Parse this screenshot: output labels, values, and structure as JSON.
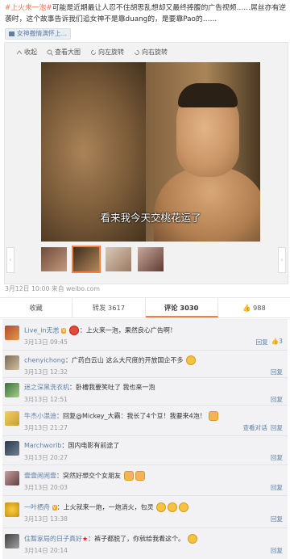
{
  "post": {
    "hashtag": "#上火来一泡#",
    "text": "可能是近期最让人忍不住胡思乱想却又最终捧腹的广告视频……屌丝亦有逆袭时，这个故事告诉我们追女神不是靠duang的，是要靠Pao的……",
    "video_link": "女神撒情满怀上..."
  },
  "toolbar": {
    "collapse": "收起",
    "view_large": "查看大图",
    "rotate_left": "向左旋转",
    "rotate_right": "向右旋转"
  },
  "image": {
    "caption": "看来我今天交桃花运了"
  },
  "meta": {
    "date_source": "3月12日 10:00 来自 weibo.com"
  },
  "actions": [
    {
      "label": "收藏"
    },
    {
      "label": "转发 3617"
    },
    {
      "label": "评论 3030"
    },
    {
      "label": "988"
    }
  ],
  "comments": [
    {
      "user": "Live_in无恙",
      "badge": "V",
      "text": "：上火来一泡，果然良心广告啊！",
      "time": "3月13日 09:45",
      "ops": [
        "回复"
      ],
      "likes": "3"
    },
    {
      "user": "chenyichong",
      "text": "：广药白云山 这么大尺度的开放国企不多",
      "time": "3月13日 12:32",
      "ops": [
        "回复"
      ]
    },
    {
      "user": "迷之深黑洗衣机",
      "text": "：卧槽我要笑吐了 我也来一泡",
      "time": "3月13日 12:51",
      "ops": [
        "回复"
      ]
    },
    {
      "user": "牛杰小混迪",
      "text": "：回复@Mickey_大霸：我长了4个豆！我要来4泡！",
      "time": "3月13日 21:27",
      "ops": [
        "查看对话",
        "回复"
      ]
    },
    {
      "user": "Marchworlb",
      "text": "：国内电影有前途了",
      "time": "3月13日 20:27",
      "ops": [
        "回复"
      ]
    },
    {
      "user": "壹壹闹闹壹",
      "text": "：突然好想交个女朋友",
      "time": "3月13日 20:03",
      "ops": [
        "回复"
      ]
    },
    {
      "user": "一叶栖舟",
      "badge": "V",
      "text": "：上火就来一炮，一炮消火，包灵",
      "time": "3月13日 13:38",
      "ops": [
        "回复"
      ]
    },
    {
      "user": "住暂家局的日子真好",
      "text": "：裤子都脱了，你就给我看这个。",
      "time": "3月14日 20:14",
      "ops": [
        "回复"
      ]
    }
  ]
}
